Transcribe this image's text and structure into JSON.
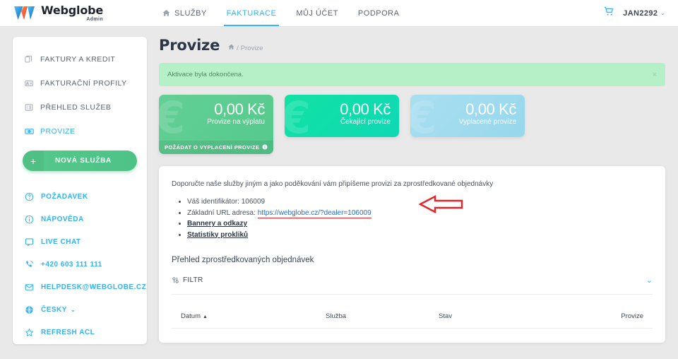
{
  "topbar": {
    "logo": {
      "name": "Webglobe",
      "sub": "Admin",
      "icon": "webglobe-w-logo"
    },
    "nav": [
      {
        "label": "SLUŽBY",
        "icon": "home-icon",
        "active": false
      },
      {
        "label": "FAKTURACE",
        "active": true
      },
      {
        "label": "MŮJ ÚČET",
        "active": false
      },
      {
        "label": "PODPORA",
        "active": false
      }
    ],
    "cart_icon": "shopping-cart-icon",
    "user": "JAN2292",
    "user_caret": "⌄",
    "accent_blue": "#35b4f7"
  },
  "sidebar": {
    "items": [
      {
        "label": "FAKTURY A KREDIT",
        "icon": "documents-icon",
        "active": false
      },
      {
        "label": "FAKTURAČNÍ PROFILY",
        "icon": "id-card-icon",
        "active": false
      },
      {
        "label": "PŘEHLED SLUŽEB",
        "icon": "list-icon",
        "active": false
      },
      {
        "label": "PROVIZE",
        "icon": "banknote-icon",
        "active": true
      }
    ],
    "new_service": {
      "label": "NOVÁ SLUŽBA",
      "plus": "+",
      "color": "#54c98a"
    },
    "contacts": [
      {
        "label": "POŽADAVEK",
        "icon": "question-circle-icon"
      },
      {
        "label": "NÁPOVĚDA",
        "icon": "info-circle-icon"
      },
      {
        "label": "LIVE CHAT",
        "icon": "chat-bubble-icon"
      },
      {
        "label": "+420 603 111 111",
        "icon": "phone-icon"
      },
      {
        "label": "HELPDESK@WEBGLOBE.CZ",
        "icon": "envelope-icon"
      },
      {
        "label": "ČESKY",
        "icon": "globe-icon",
        "caret": "⌄"
      },
      {
        "label": "REFRESH ACL",
        "icon": "star-icon"
      }
    ],
    "link_color": "#2fb3f6"
  },
  "main": {
    "page_title": "Provize",
    "breadcrumb_home_icon": "home-icon",
    "breadcrumb_sep": "/",
    "breadcrumb_current": "Provize",
    "alert": {
      "text": "Aktivace byla dokončena.",
      "close": "×",
      "bg": "#b6f0c7"
    },
    "cards": [
      {
        "amount": "0,00 Kč",
        "label": "Provize na výplatu",
        "color": "#5cc98e",
        "glyph": "€",
        "action_label": "POŽÁDAT O VYPLACENÍ PROVIZE",
        "action_icon": "info-circle-icon"
      },
      {
        "amount": "0,00 Kč",
        "label": "Čekající provize",
        "color": "#10ddaa",
        "glyph": "€"
      },
      {
        "amount": "0,00 Kč",
        "label": "Vyplacené provize",
        "color": "#9fdcee",
        "glyph": "€"
      }
    ],
    "panel": {
      "intro": "Doporučte naše služby jiným a jako poděkování vám připíšeme provizi za zprostředkované objednávky",
      "bullets": [
        {
          "text": "Váš identifikátor: 106009",
          "type": "plain"
        },
        {
          "prefix": "Základní URL adresa: ",
          "url": "https://webglobe.cz/?dealer=106009",
          "type": "url"
        },
        {
          "text": "Bannery a odkazy",
          "type": "link"
        },
        {
          "text": "Statistiky prokliků",
          "type": "link"
        }
      ],
      "annotation": {
        "shape": "left-arrow",
        "color": "#e8232a"
      },
      "section_title": "Přehled zprostředkovaných objednávek",
      "filter": {
        "label": "FILTR",
        "icon": "sliders-icon",
        "caret": "⌄"
      },
      "table": {
        "columns": [
          {
            "label": "Datum",
            "sorted": true,
            "sort_caret": "▲"
          },
          {
            "label": "Služba"
          },
          {
            "label": "Stav"
          },
          {
            "label": "Provize"
          }
        ],
        "rows": []
      }
    }
  }
}
